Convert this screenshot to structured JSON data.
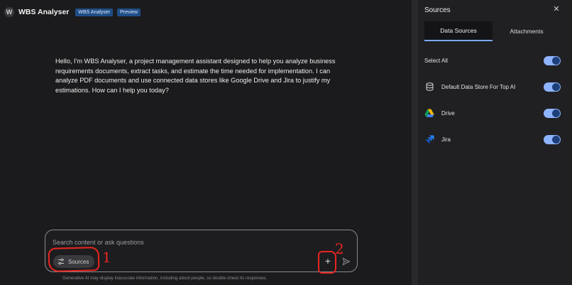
{
  "app": {
    "avatar_letter": "W",
    "title": "WBS Analyser",
    "badges": [
      "WBS Analyser",
      "Preview"
    ]
  },
  "chat": {
    "assistant_message": "Hello, I'm WBS Analyser, a project management assistant designed to help you analyze business requirements documents, extract tasks, and estimate the time needed for implementation. I can analyze PDF documents and use connected data stores like Google Drive and Jira to justify my estimations. How can I help you today?"
  },
  "composer": {
    "placeholder": "Search content or ask questions",
    "sources_label": "Sources",
    "plus_label": "+",
    "disclaimer": "Generative AI may display inaccurate information, including about people, so double-check its responses."
  },
  "annotations": {
    "mark_1": "1",
    "mark_2": "2",
    "color": "#e8251f"
  },
  "panel": {
    "title": "Sources",
    "close_icon": "close-icon",
    "tabs": [
      "Data Sources",
      "Attachments"
    ],
    "active_tab": "Data Sources",
    "select_all_label": "Select All",
    "sources": [
      {
        "label": "Default Data Store For Top AI",
        "icon": "database-icon",
        "enabled": true
      },
      {
        "label": "Drive",
        "icon": "google-drive-icon",
        "enabled": true
      },
      {
        "label": "Jira",
        "icon": "jira-icon",
        "enabled": true
      }
    ],
    "select_all_enabled": true
  },
  "colors": {
    "background": "#1b1b1d",
    "panel": "#202023",
    "accent": "#8fb4ff",
    "badge": "#1f4e86"
  }
}
